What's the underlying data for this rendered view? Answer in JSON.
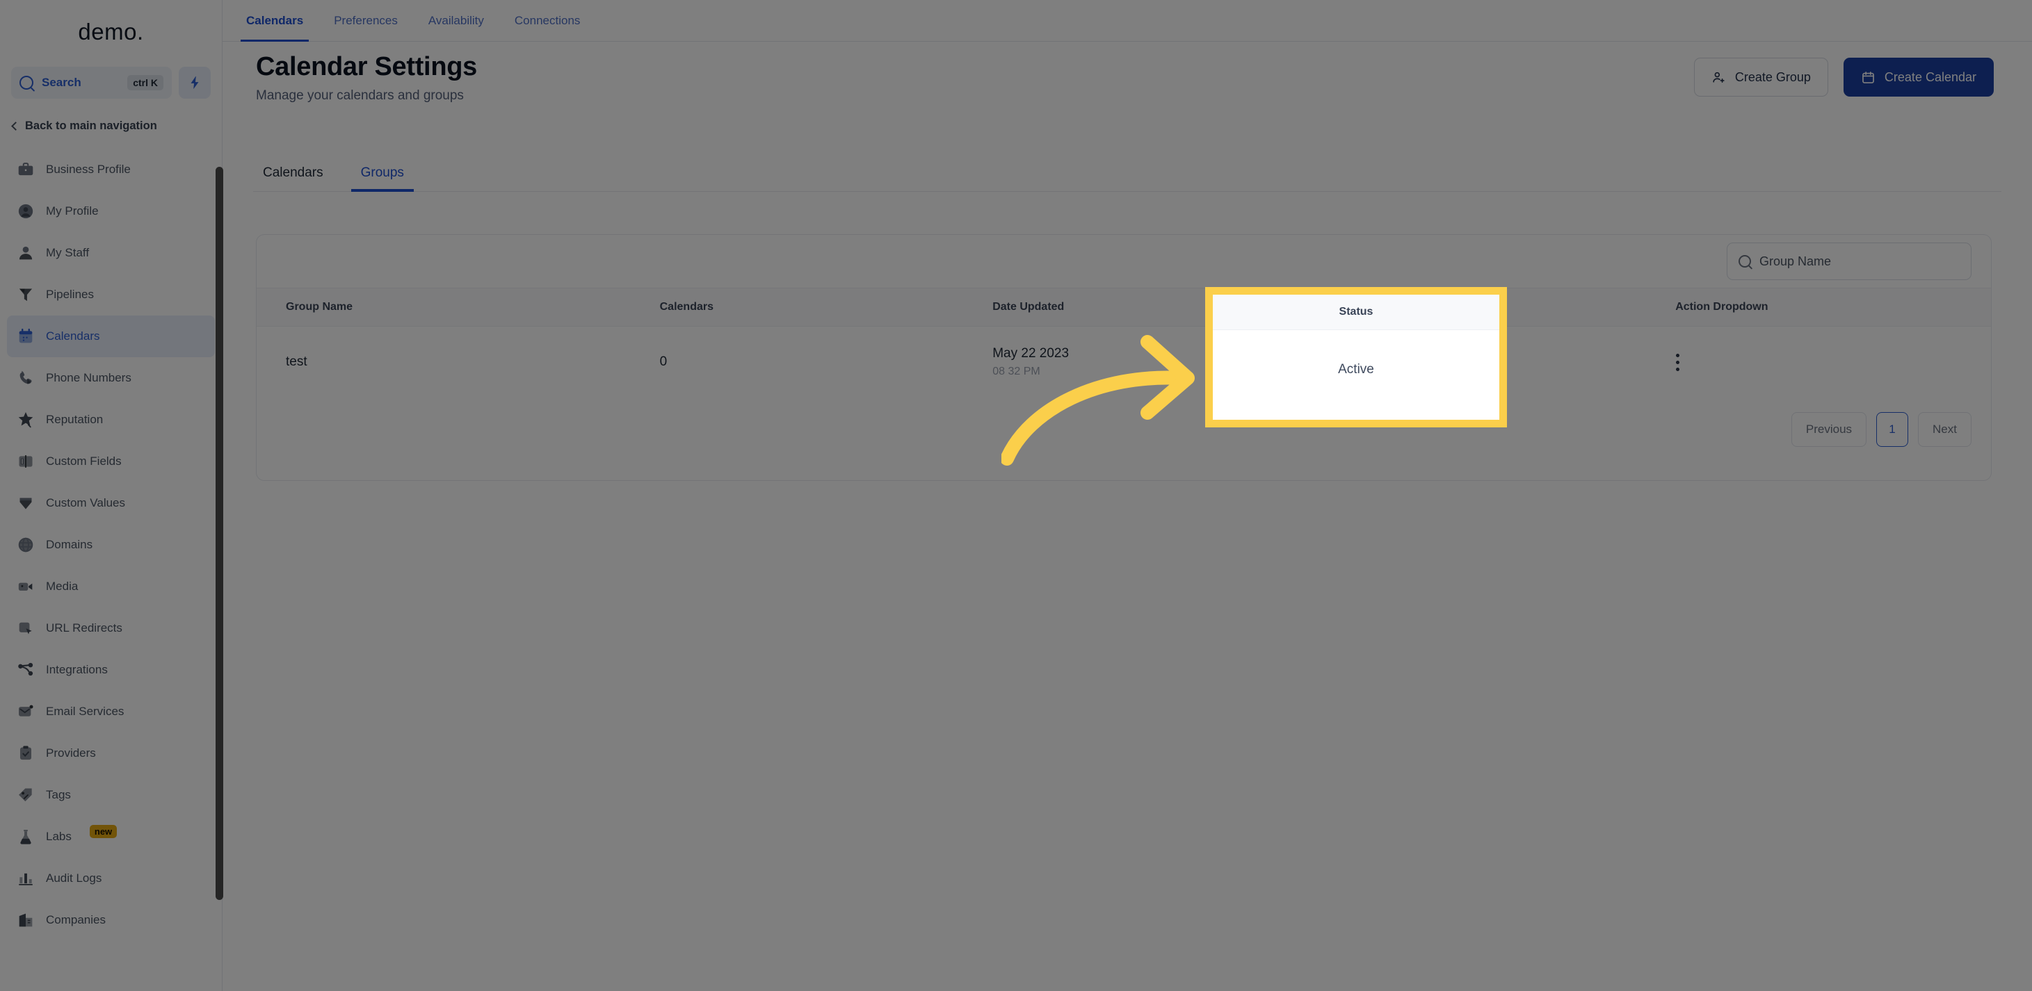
{
  "brand": {
    "logo": "demo."
  },
  "sidebar": {
    "search": {
      "label": "Search",
      "shortcut": "ctrl K",
      "icon": "search-icon"
    },
    "quick_action_icon": "lightning-bolt-icon",
    "back_label": "Back to main navigation",
    "items": [
      {
        "label": "Business Profile",
        "icon": "briefcase-icon",
        "active": false
      },
      {
        "label": "My Profile",
        "icon": "user-circle-icon",
        "active": false
      },
      {
        "label": "My Staff",
        "icon": "user-icon",
        "active": false
      },
      {
        "label": "Pipelines",
        "icon": "funnel-icon",
        "active": false
      },
      {
        "label": "Calendars",
        "icon": "calendar-icon",
        "active": true
      },
      {
        "label": "Phone Numbers",
        "icon": "phone-icon",
        "active": false
      },
      {
        "label": "Reputation",
        "icon": "star-icon",
        "active": false
      },
      {
        "label": "Custom Fields",
        "icon": "field-icon",
        "active": false
      },
      {
        "label": "Custom Values",
        "icon": "gem-icon",
        "active": false
      },
      {
        "label": "Domains",
        "icon": "globe-icon",
        "active": false
      },
      {
        "label": "Media",
        "icon": "video-camera-icon",
        "active": false
      },
      {
        "label": "URL Redirects",
        "icon": "cursor-click-icon",
        "active": false
      },
      {
        "label": "Integrations",
        "icon": "nodes-icon",
        "active": false
      },
      {
        "label": "Email Services",
        "icon": "envelope-icon",
        "active": false
      },
      {
        "label": "Providers",
        "icon": "clipboard-check-icon",
        "active": false
      },
      {
        "label": "Tags",
        "icon": "tag-icon",
        "active": false
      },
      {
        "label": "Labs",
        "icon": "flask-icon",
        "active": false,
        "badge": "new"
      },
      {
        "label": "Audit Logs",
        "icon": "bar-chart-icon",
        "active": false
      },
      {
        "label": "Companies",
        "icon": "building-icon",
        "active": false
      }
    ]
  },
  "top_tabs": [
    {
      "label": "Calendars",
      "active": true
    },
    {
      "label": "Preferences",
      "active": false
    },
    {
      "label": "Availability",
      "active": false
    },
    {
      "label": "Connections",
      "active": false
    }
  ],
  "header": {
    "title": "Calendar Settings",
    "subtitle": "Manage your calendars and groups",
    "create_group_label": "Create Group",
    "create_group_icon": "user-plus-icon",
    "create_calendar_label": "Create Calendar",
    "create_calendar_icon": "calendar-icon"
  },
  "sub_tabs": [
    {
      "label": "Calendars",
      "active": false
    },
    {
      "label": "Groups",
      "active": true
    }
  ],
  "card": {
    "search": {
      "placeholder": "Group Name",
      "icon": "search-icon"
    },
    "table": {
      "columns": [
        "Group Name",
        "Calendars",
        "Date Updated",
        "Status",
        "Action Dropdown"
      ],
      "rows": [
        {
          "group_name": "test",
          "calendars": "0",
          "date_updated": "May 22 2023",
          "time_updated": "08 32 PM",
          "status": "Active",
          "action_icon": "kebab-menu-icon"
        }
      ]
    },
    "pagination": {
      "previous_label": "Previous",
      "current_page": "1",
      "next_label": "Next"
    }
  },
  "annotation": {
    "highlight_color": "#FBCF4B",
    "arrow_color": "#FBCF4B",
    "highlight_target": "Status"
  },
  "colors": {
    "accent_blue": "#1f4fd0",
    "primary_button": "#1b3fa0",
    "highlight_yellow": "#FBCF4B",
    "badge_amber": "#e5a812"
  }
}
